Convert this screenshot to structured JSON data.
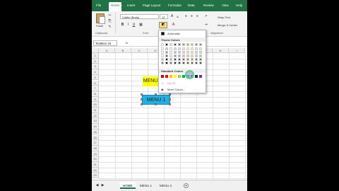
{
  "ribbon_tabs": [
    "File",
    "Home",
    "Insert",
    "Page Layout",
    "Formulas",
    "Data",
    "Review",
    "View",
    "Help"
  ],
  "ribbon": {
    "paste_label": "Paste",
    "clipboard_label": "Clipboard",
    "font_name": "Calibri (Body)",
    "font_size": "12",
    "font_group_label": "Font",
    "alignment_label": "Alignment",
    "wrap_text": "Wrap Text",
    "merge_center": "Merge & Center",
    "bold": "B",
    "italic": "I",
    "underline": "U"
  },
  "formula_bar": {
    "name_box": "TextBox 10",
    "fx": "fx"
  },
  "columns": [
    "A",
    "B",
    "C",
    "D",
    "E",
    "F",
    "G",
    "H",
    "I"
  ],
  "rows": [
    "1",
    "2",
    "3",
    "4",
    "5",
    "6",
    "7",
    "8",
    "9",
    "10",
    "11",
    "12",
    "13",
    "14",
    "15",
    "16",
    "17",
    "18",
    "19",
    "20",
    "21",
    "22",
    "23"
  ],
  "shapes": [
    {
      "label": "MENU",
      "fill": "#ffff00"
    },
    {
      "label": "MENU 1",
      "fill": "#1fb0e6"
    }
  ],
  "color_dropdown": {
    "automatic": "Automatic",
    "theme_colors": "Theme Colors",
    "standard_colors": "Standard Colors",
    "no_fill": "No Fill",
    "more_colors": "More Colors..."
  },
  "theme_swatches": [
    "#ffffff",
    "#000000",
    "#e7e6e6",
    "#44546a",
    "#4472c4",
    "#ed7d31",
    "#a5a5a5",
    "#ffc000",
    "#5b9bd5",
    "#70ad47"
  ],
  "standard_swatches": [
    "#c00000",
    "#ff0000",
    "#ffc000",
    "#ffff00",
    "#92d050",
    "#00b050",
    "#00b0f0",
    "#0070c0",
    "#002060",
    "#7030a0"
  ],
  "sheet_tabs": [
    "HOME",
    "MENU 1",
    "MENU 2"
  ],
  "colors": {
    "excel_green": "#217346"
  }
}
